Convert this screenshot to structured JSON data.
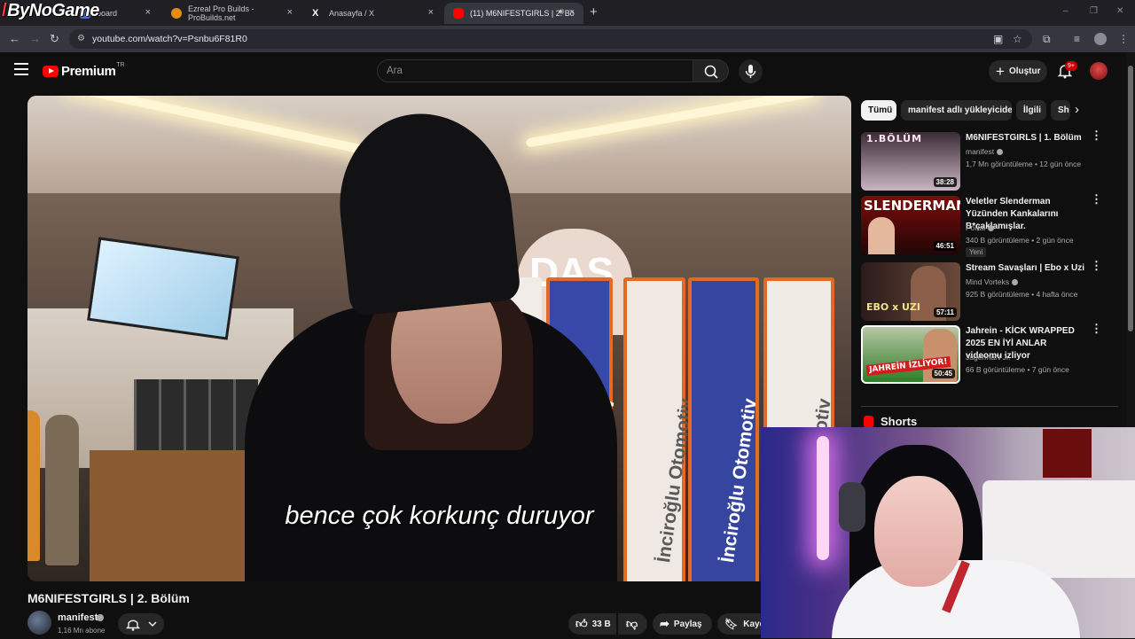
{
  "browser": {
    "overlay_logo": "ByNoGame",
    "tabs": [
      {
        "label": "board",
        "favicon_color": "#3d6fd6"
      },
      {
        "label": "Ezreal Pro Builds - ProBuilds.net",
        "favicon_color": "#e58b12"
      },
      {
        "label": "Anasayfa / X",
        "favicon_icon": "x-logo-icon"
      },
      {
        "label": "(11) M6NIFESTGIRLS | 2. Bö",
        "favicon_color": "#ff0000",
        "active": true
      }
    ],
    "tab_close_glyph": "×",
    "new_tab_glyph": "+",
    "url": "youtube.com/watch?v=Psnbu6F81R0",
    "window_controls": [
      "–",
      "❐",
      "✕"
    ]
  },
  "youtube_header": {
    "logo_word": "Premium",
    "logo_country": "TR",
    "search_placeholder": "Ara",
    "create_label": "Oluştur",
    "notification_count": "9+"
  },
  "player": {
    "subtitle": "bence çok korkunç duruyor",
    "scene_sign": "DAS",
    "banner_text": "İnciroğlu Otomotiv"
  },
  "video_info": {
    "title": "M6NIFESTGIRLS | 2. Bölüm",
    "channel_name": "manifest",
    "channel_subscribers": "1,16 Mn abone",
    "like_count": "33 B",
    "share_label": "Paylaş",
    "save_label": "Kayde"
  },
  "filter_chips": [
    {
      "label": "Tümü",
      "active": true
    },
    {
      "label": "manifest adlı yükleyiciden",
      "active": false
    },
    {
      "label": "İlgili",
      "active": false
    },
    {
      "label": "Sh",
      "active": false
    }
  ],
  "recommendations": [
    {
      "title": "M6NIFESTGIRLS | 1. Bölüm",
      "channel": "manifest",
      "verified": true,
      "meta": "1,7 Mn görüntüleme • 12 gün önce",
      "duration": "38:28",
      "thumb_text": "1.BÖLÜM",
      "thumb_colors": [
        "#3a2b35",
        "#c9b6c2"
      ]
    },
    {
      "title": "Veletler Slenderman Yüzünden Kankalarını B*çaklamışlar.",
      "channel": "Portal",
      "verified": true,
      "meta": "340 B görüntüleme • 2 gün önce",
      "badge": "Yeni",
      "duration": "46:51",
      "thumb_text": "SLENDERMAN",
      "thumb_colors": [
        "#7a0c0c",
        "#220505"
      ]
    },
    {
      "title": "Stream Savaşları | Ebo x Uzi",
      "channel": "Mind Vorteks",
      "verified": true,
      "meta": "925 B görüntüleme • 4 hafta önce",
      "duration": "57:11",
      "thumb_text": "EBO x UZI",
      "thumb_colors": [
        "#2a1b1b",
        "#6a4a3a"
      ]
    },
    {
      "title": "Jahrein - KİCK WRAPPED 2025 EN İYİ ANLAR videomu izliyor",
      "channel": "JagermaN Jr.",
      "verified": false,
      "meta": "66 B görüntüleme • 7 gün önce",
      "duration": "50:45",
      "thumb_text": "JAHREİN İZLİYOR!",
      "thumb_colors": [
        "#2f7d2a",
        "#b9c7a5"
      ]
    }
  ],
  "shorts": {
    "title": "Shorts"
  },
  "colors": {
    "accent": "#ff0000",
    "background": "#0f0f0f",
    "chip": "#272727"
  }
}
